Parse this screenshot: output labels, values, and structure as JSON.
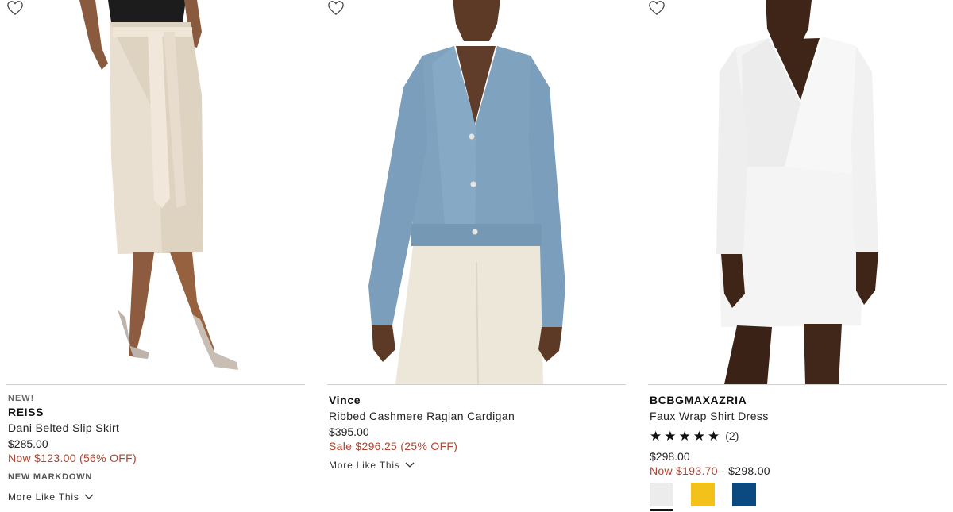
{
  "products": [
    {
      "badge": "NEW!",
      "brand": "REISS",
      "title": "Dani Belted Slip Skirt",
      "price": "$285.00",
      "sale": "Now $123.00 (56% OFF)",
      "markdown": "NEW MARKDOWN",
      "more_like_this": "More Like This"
    },
    {
      "brand": "Vince",
      "title": "Ribbed Cashmere Raglan Cardigan",
      "price": "$395.00",
      "sale": "Sale $296.25 (25% OFF)",
      "more_like_this": "More Like This"
    },
    {
      "brand": "BCBGMAXAZRIA",
      "title": "Faux Wrap Shirt Dress",
      "rating_stars": 5,
      "rating_count": "(2)",
      "price": "$298.00",
      "sale_prefix": "Now $193.70",
      "sale_dash": " - ",
      "sale_range_end": "$298.00",
      "swatches": [
        {
          "color": "#ececec",
          "selected": true
        },
        {
          "color": "#f2c21b",
          "selected": false
        },
        {
          "color": "#0b4a80",
          "selected": false
        }
      ]
    }
  ],
  "icons": {
    "wishlist": "heart-outline-icon",
    "expand": "chevron-down-icon",
    "star": "star-filled-icon"
  },
  "colors": {
    "sale_red": "#b0442e",
    "divider": "#cfcfcf"
  }
}
